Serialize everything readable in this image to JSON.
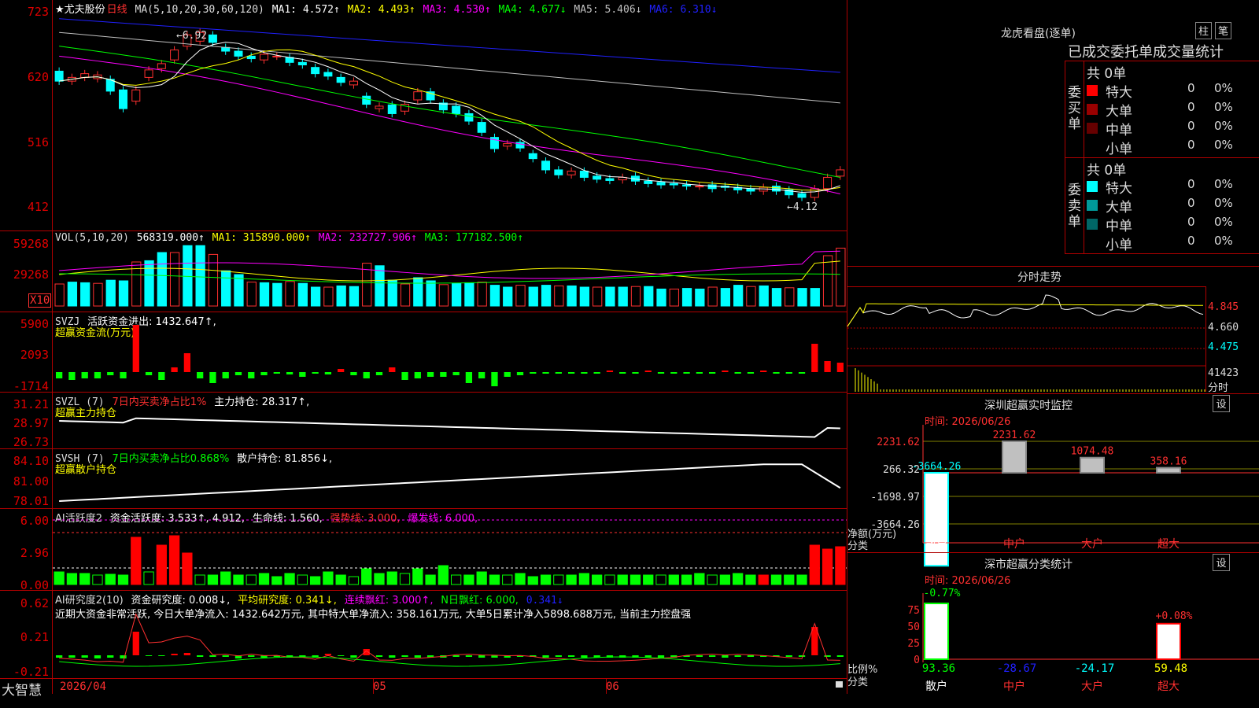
{
  "main_chart": {
    "star_name": "★尤夫股份",
    "period": "日线",
    "ma_header": "MA(5,10,20,30,60,120)",
    "ma1": "MA1: 4.572↑",
    "ma2": "MA2: 4.493↑",
    "ma3": "MA3: 4.530↑",
    "ma4": "MA4: 4.677↓",
    "ma5": "MA5: 5.406↓",
    "ma6": "MA6: 6.310↓",
    "y_ticks": [
      "723",
      "620",
      "516",
      "412"
    ],
    "high_note": "←6.92",
    "low_note": "←4.12",
    "colors": {
      "up": "#ff3030",
      "down": "#00ffff",
      "ma1": "#ffffff",
      "ma2": "#ffff00",
      "ma3": "#ff00ff",
      "ma4": "#00ff00",
      "ma5": "#c0c0c0",
      "ma6": "#2020ff"
    }
  },
  "vol_panel": {
    "header": "VOL(5,10,20)",
    "value": "568319.000↑",
    "ma1": "MA1: 315890.000↑",
    "ma2": "MA2: 232727.906↑",
    "ma3": "MA3: 177182.500↑",
    "y_ticks": [
      "59268",
      "29268"
    ],
    "unit": "X10"
  },
  "svzj_panel": {
    "header": "SVZJ",
    "label": "活跃资金进出: 1432.647↑,",
    "sub": "超赢资金流(万元)",
    "y_ticks": [
      "5900",
      "2093",
      "-1714"
    ]
  },
  "svzl_panel": {
    "header": "SVZL (7)",
    "label1": "7日内买卖净占比1%",
    "label2": "主力持仓: 28.317↑,",
    "sub": "超赢主力持仓",
    "y_ticks": [
      "31.21",
      "28.97",
      "26.73"
    ]
  },
  "svsh_panel": {
    "header": "SVSH (7)",
    "label1": "7日内买卖净占比0.868%",
    "label2": "散户持仓: 81.856↓,",
    "sub": "超赢散户持仓",
    "y_ticks": [
      "84.10",
      "81.00",
      "78.01"
    ]
  },
  "ai_active_panel": {
    "header": "AI活跃度2",
    "label1": "资金活跃度: 3.533↑, 4.912,",
    "label2": "生命线: 1.560,",
    "label3": "强势线: 3.000,",
    "label4": "爆发线: 6.000,",
    "y_ticks": [
      "6.00",
      "2.96",
      "0.00"
    ]
  },
  "ai_research_panel": {
    "header": "AI研究度2(10)",
    "label1": "资金研究度: 0.008↓,",
    "label2": "平均研究度: 0.341↓,",
    "label3": "连续飘红: 3.000↑,",
    "label4": "N日飘红: 6.000,",
    "label5": "0.341↓",
    "comment": "近期大资金非常活跃, 今日大单净流入: 1432.642万元, 其中特大单净流入: 358.161万元, 大单5日累计净入5898.688万元, 当前主力控盘强",
    "y_ticks": [
      "0.62",
      "0.21",
      "-0.21"
    ]
  },
  "bottom_axis": {
    "brand": "大智慧",
    "dates": [
      "2026/04",
      "05",
      "06"
    ]
  },
  "dragon_panel": {
    "title": "龙虎看盘(逐单)",
    "btn1": "柱",
    "btn2": "笔",
    "subtitle": "已成交委托单成交量统计",
    "buy_label": "委买单",
    "sell_label": "委卖单",
    "buy_total": "共 0单",
    "sell_total": "共 0单",
    "buy_rows": [
      {
        "name": "特大",
        "count": "0",
        "pct": "0%",
        "color": "#ff0000"
      },
      {
        "name": "大单",
        "count": "0",
        "pct": "0%",
        "color": "#990000"
      },
      {
        "name": "中单",
        "count": "0",
        "pct": "0%",
        "color": "#660000"
      },
      {
        "name": "小单",
        "count": "0",
        "pct": "0%",
        "color": "#000000"
      }
    ],
    "sell_rows": [
      {
        "name": "特大",
        "count": "0",
        "pct": "0%",
        "color": "#00ffff"
      },
      {
        "name": "大单",
        "count": "0",
        "pct": "0%",
        "color": "#009999"
      },
      {
        "name": "中单",
        "count": "0",
        "pct": "0%",
        "color": "#006666"
      },
      {
        "name": "小单",
        "count": "0",
        "pct": "0%",
        "color": "#000000"
      }
    ]
  },
  "intraday_panel": {
    "title": "分时走势",
    "prices": [
      "4.845",
      "4.660",
      "4.475"
    ],
    "volume": "41423",
    "unit": "分时"
  },
  "monitor_panel": {
    "title": "深圳超赢实时监控",
    "btn": "设",
    "time": "时间: 2026/06/26",
    "y_ticks": [
      "2231.62",
      "266.32",
      "-1698.97",
      "-3664.26"
    ],
    "y_caption": "净额(万元)",
    "x_caption": "分类",
    "categories": [
      "散户",
      "中户",
      "大户",
      "超大"
    ],
    "values": [
      -3664.26,
      2231.62,
      1074.48,
      358.16
    ],
    "labels": [
      "-3664.26",
      "2231.62",
      "1074.48",
      "358.16"
    ]
  },
  "classify_panel": {
    "title": "深市超赢分类统计",
    "btn": "设",
    "time": "时间: 2026/06/26",
    "y_ticks": [
      "75",
      "50",
      "25",
      "0"
    ],
    "y_caption": "比例%",
    "x_caption": "分类",
    "categories": [
      "散户",
      "中户",
      "大户",
      "超大"
    ],
    "bottom_values": [
      "93.36",
      "-28.67",
      "-24.17",
      "59.48"
    ],
    "top_labels": [
      "-0.77%",
      "",
      "",
      "+0.08%"
    ]
  }
}
